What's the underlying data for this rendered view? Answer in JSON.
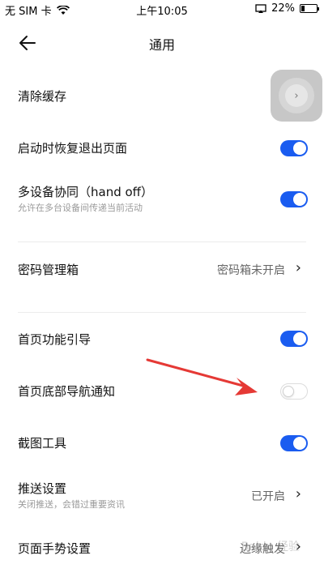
{
  "status": {
    "carrier": "无 SIM 卡",
    "time": "上午10:05",
    "battery": "22%",
    "battery_level": 0.22
  },
  "nav": {
    "title": "通用"
  },
  "settings": {
    "clear_cache": {
      "label": "清除缓存"
    },
    "restore_pages": {
      "label": "启动时恢复退出页面",
      "enabled": true
    },
    "handoff": {
      "label": "多设备协同（hand off）",
      "sub": "允许在多台设备间传递当前活动",
      "enabled": true
    },
    "password": {
      "label": "密码管理箱",
      "value": "密码箱未开启"
    },
    "home_guide": {
      "label": "首页功能引导",
      "enabled": true
    },
    "bottom_nav_notice": {
      "label": "首页底部导航通知",
      "enabled": false
    },
    "screenshot_tool": {
      "label": "截图工具",
      "enabled": true
    },
    "push": {
      "label": "推送设置",
      "sub": "关闭推送，会错过重要资讯",
      "value": "已开启"
    },
    "gesture": {
      "label": "页面手势设置",
      "value": "边缘触发"
    }
  },
  "colors": {
    "accent": "#1a5cf0",
    "annotation_arrow": "#e53935"
  }
}
